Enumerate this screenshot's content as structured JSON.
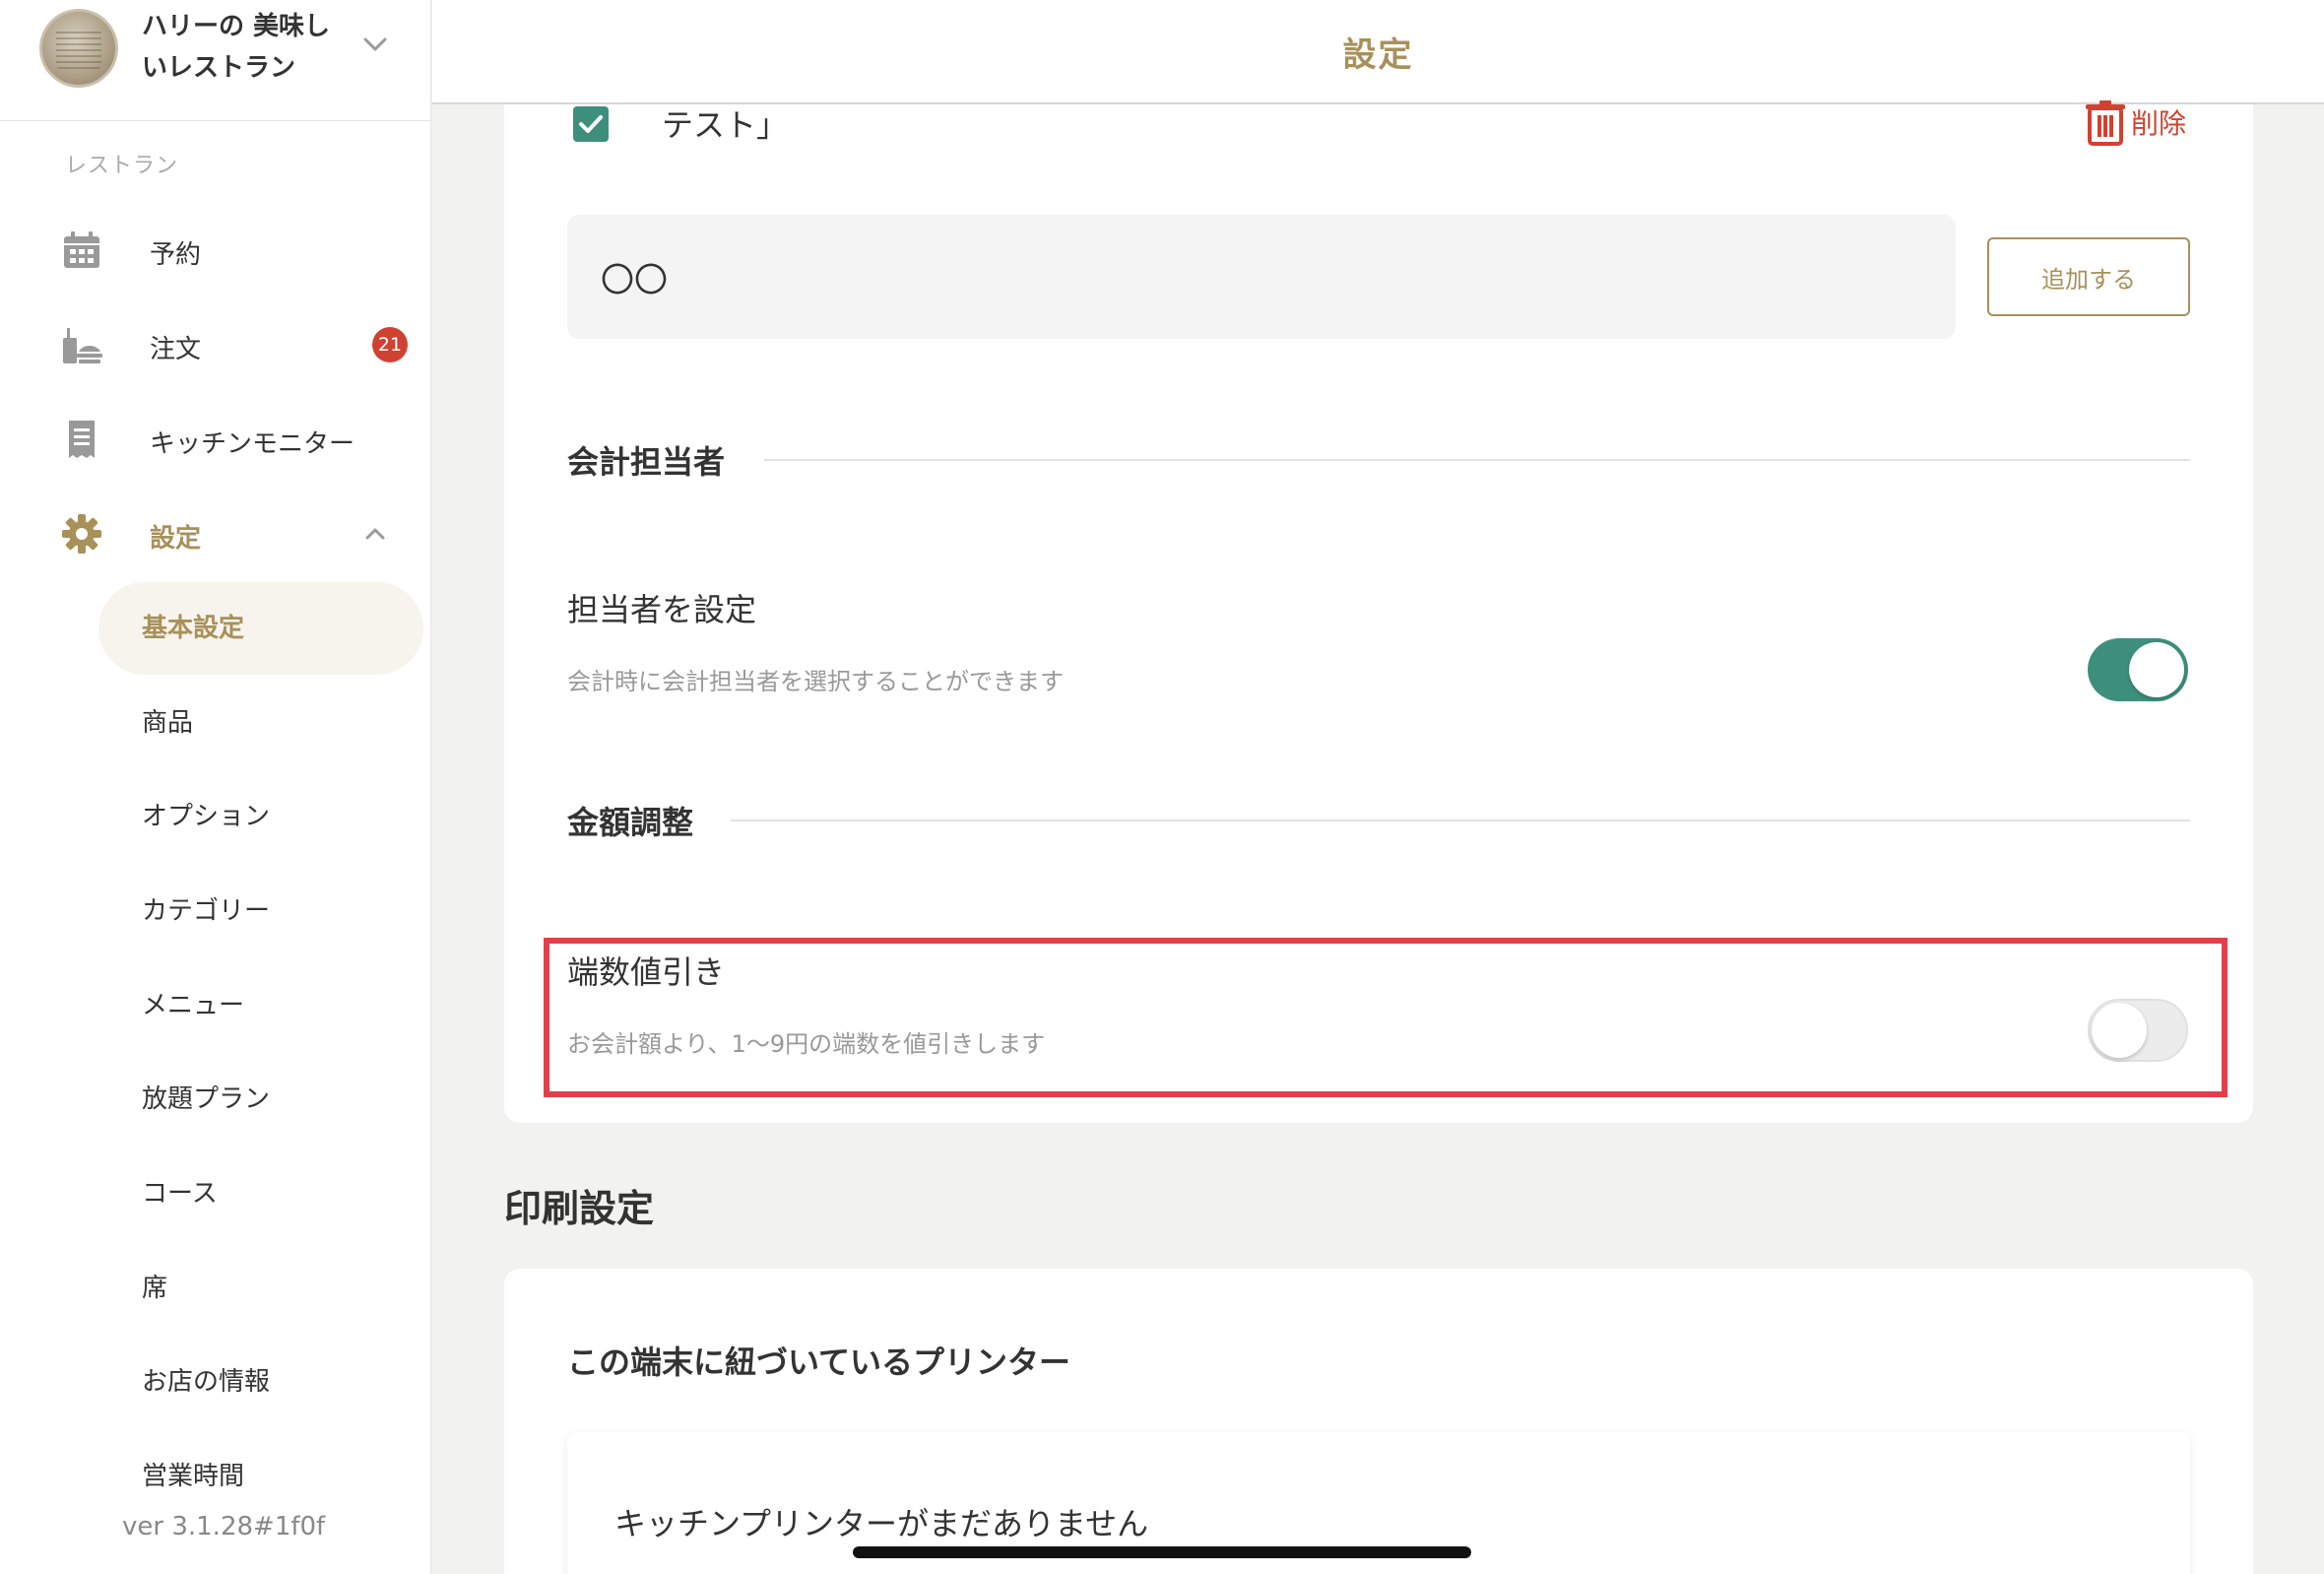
{
  "sidebar": {
    "restaurant_name": "ハリーの 美味しいレストラン",
    "section_label": "レストラン",
    "nav": {
      "reservations": "予約",
      "orders": "注文",
      "orders_badge": "21",
      "kitchen_monitor": "キッチンモニター",
      "settings": "設定"
    },
    "sub_items": [
      "基本設定",
      "商品",
      "オプション",
      "カテゴリー",
      "メニュー",
      "放題プラン",
      "コース",
      "席",
      "お店の情報",
      "営業時間"
    ],
    "version": "ver 3.1.28#1f0f"
  },
  "header": {
    "title": "設定"
  },
  "main": {
    "list_item_text": "テスト」",
    "list_item_checked": true,
    "delete_label": "削除",
    "new_item_input_value": "〇〇",
    "add_button_label": "追加する",
    "cashier_section": {
      "heading": "会計担当者",
      "row_title": "担当者を設定",
      "row_desc": "会計時に会計担当者を選択することができます",
      "toggle_on": true
    },
    "amount_section": {
      "heading": "金額調整",
      "row_title": "端数値引き",
      "row_desc": "お会計額より、1〜9円の端数を値引きします",
      "toggle_on": false
    },
    "print_settings": {
      "heading": "印刷設定",
      "subheading": "この端末に紐づいているプリンター",
      "empty_message": "キッチンプリンターがまだありません"
    }
  },
  "colors": {
    "accent": "#a8905a",
    "toggle_on": "#3d8f7b",
    "danger": "#cf4232",
    "highlight": "#e0404c"
  }
}
